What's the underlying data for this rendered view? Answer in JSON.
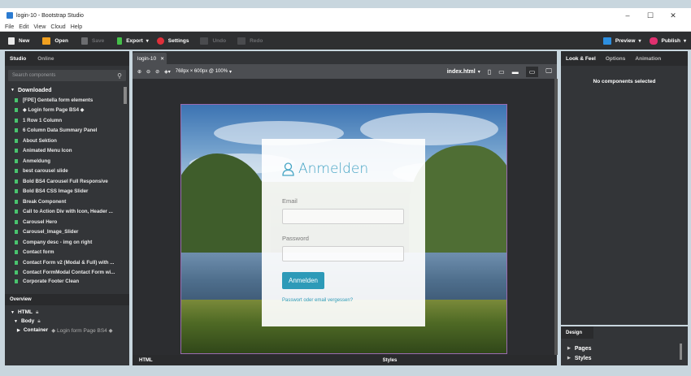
{
  "window": {
    "title": "login-10 - Bootstrap Studio",
    "controls": [
      "–",
      "☐",
      "✕"
    ]
  },
  "menu": [
    "File",
    "Edit",
    "View",
    "Cloud",
    "Help"
  ],
  "toolbar": {
    "new": "New",
    "open": "Open",
    "save": "Save",
    "export": "Export",
    "settings": "Settings",
    "undo": "Undo",
    "redo": "Redo",
    "preview": "Preview",
    "publish": "Publish"
  },
  "left_panel": {
    "tabs": [
      "Studio",
      "Online"
    ],
    "search_placeholder": "Search components",
    "group": "Downloaded",
    "components": [
      "[FPE] Gentella form elements",
      "◆ Login form Page BS4 ◆",
      "1 Row 1 Column",
      "6 Column Data Summary Panel",
      "About Sektion",
      "Animated Menu Icon",
      "Anmeldung",
      "best carousel slide",
      "Bold BS4 Carousel Full Responsive",
      "Bold BS4 CSS Image Slider",
      "Break Component",
      "Call to Action Div with Icon, Header ...",
      "Carousel Hero",
      "Carousel_Image_Slider",
      "Company desc - img on right",
      "Contact form",
      "Contact Form v2 (Modal & Full) with ...",
      "Contact FormModal Contact Form wi...",
      "Corporate Footer Clean"
    ]
  },
  "overview": {
    "tab": "Overview",
    "html": "HTML",
    "body": "Body",
    "container": "Container",
    "container_sub": "◆ Login form Page BS4 ◆"
  },
  "editor": {
    "tab": "login-10",
    "viewport": "768px × 600px @ 100%",
    "page_select": "index.html",
    "bottom_html": "HTML",
    "bottom_styles": "Styles"
  },
  "login_form": {
    "title": "Anmelden",
    "email_label": "Email",
    "password_label": "Password",
    "button": "Anmelden",
    "forgot": "Passwort oder email vergessen?"
  },
  "right_panel": {
    "tabs": [
      "Look & Feel",
      "Options",
      "Animation"
    ],
    "empty": "No components selected"
  },
  "design_panel": {
    "tab": "Design",
    "pages": "Pages",
    "styles": "Styles"
  }
}
